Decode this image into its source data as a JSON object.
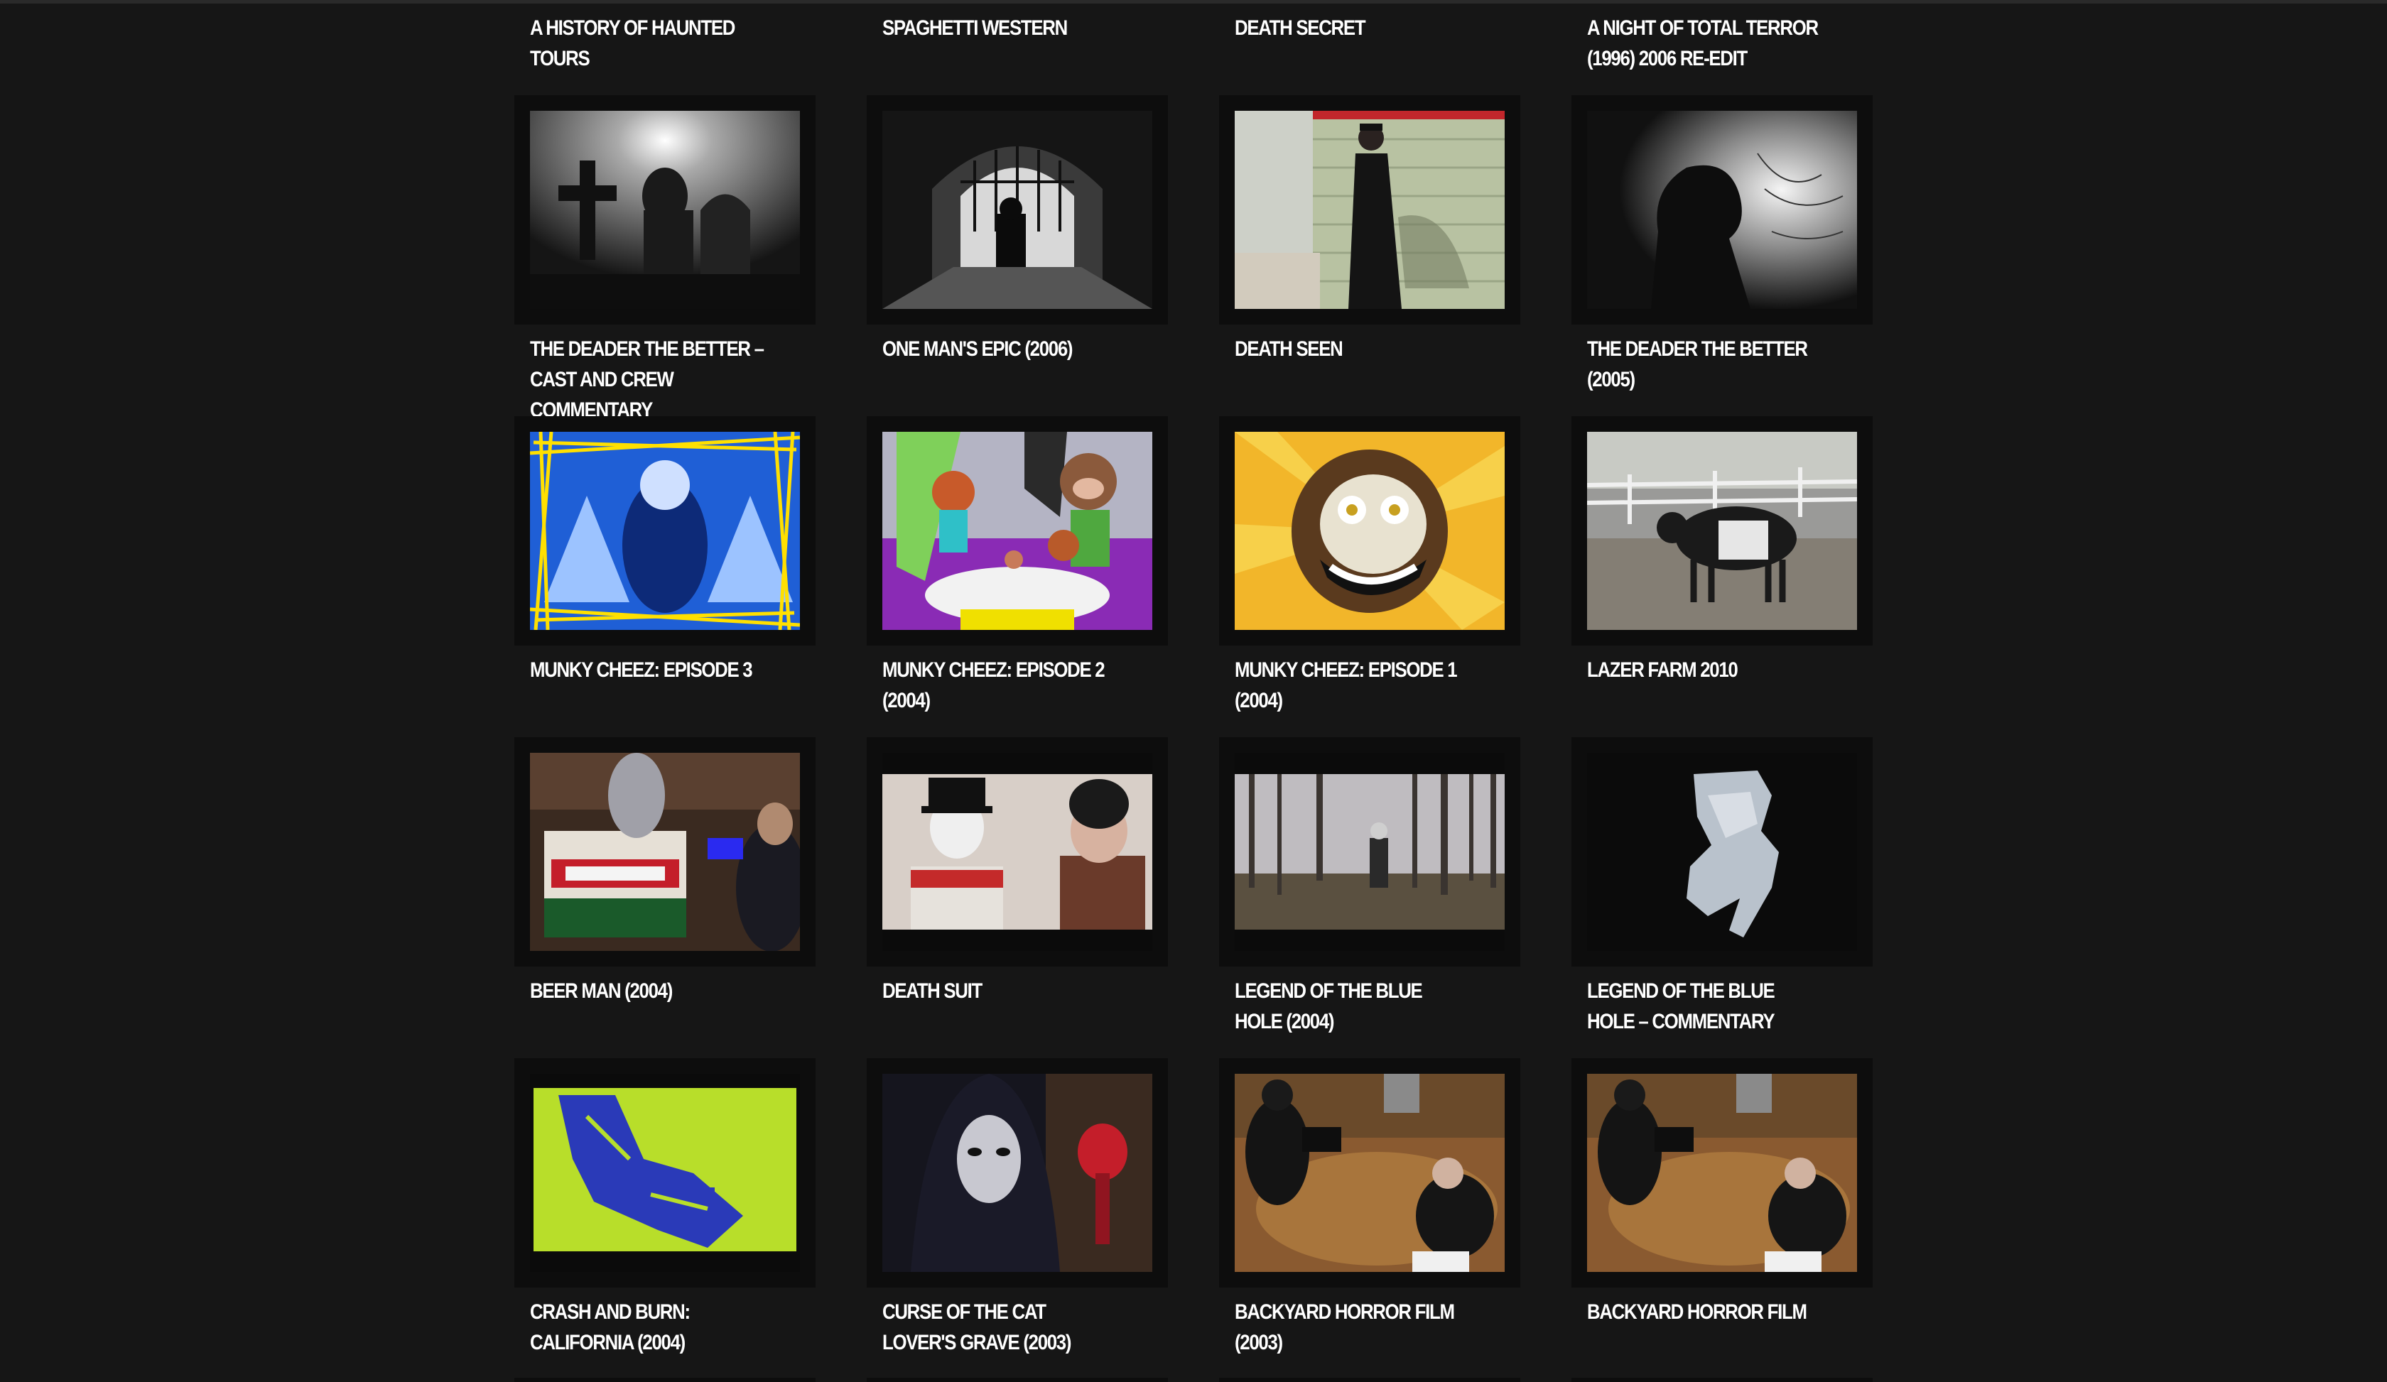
{
  "page": {
    "background": "#161616",
    "text_color": "#ffffff"
  },
  "top_row": [
    {
      "title": "A HISTORY OF HAUNTED TOURS"
    },
    {
      "title": "SPAGHETTI WESTERN"
    },
    {
      "title": "DEATH SECRET"
    },
    {
      "title": "A NIGHT OF TOTAL TERROR (1996) 2006 RE-EDIT"
    }
  ],
  "videos": [
    {
      "title": "THE DEADER THE BETTER – CAST AND CREW COMMENTARY",
      "thumb": "graveyard-silhouette"
    },
    {
      "title": "ONE MAN'S EPIC (2006)",
      "thumb": "tunnel-walk"
    },
    {
      "title": "DEATH SEEN",
      "thumb": "man-on-porch"
    },
    {
      "title": "THE DEADER THE BETTER (2005)",
      "thumb": "foggy-profile"
    },
    {
      "title": "MUNKY CHEEZ: EPISODE 3",
      "thumb": "blue-puppet"
    },
    {
      "title": "MUNKY CHEEZ: EPISODE 2 (2004)",
      "thumb": "cartoon-family"
    },
    {
      "title": "MUNKY CHEEZ: EPISODE 1 (2004)",
      "thumb": "cartoon-monkey"
    },
    {
      "title": "LAZER FARM 2010",
      "thumb": "cow-in-yard"
    },
    {
      "title": "BEER MAN (2004)",
      "thumb": "molson-beer"
    },
    {
      "title": "DEATH SUIT",
      "thumb": "two-men-hats"
    },
    {
      "title": "LEGEND OF THE BLUE HOLE (2004)",
      "thumb": "forest"
    },
    {
      "title": "LEGEND OF THE BLUE HOLE – COMMENTARY",
      "thumb": "new-jersey-map"
    },
    {
      "title": "CRASH AND BURN: CALIFORNIA (2004)",
      "thumb": "green-blue-abstract"
    },
    {
      "title": "CURSE OF THE CAT LOVER'S GRAVE (2003)",
      "thumb": "masked-figure"
    },
    {
      "title": "BACKYARD HORROR FILM (2003)",
      "thumb": "film-crew-grave"
    },
    {
      "title": "BACKYARD HORROR FILM",
      "thumb": "film-crew-grave"
    }
  ]
}
